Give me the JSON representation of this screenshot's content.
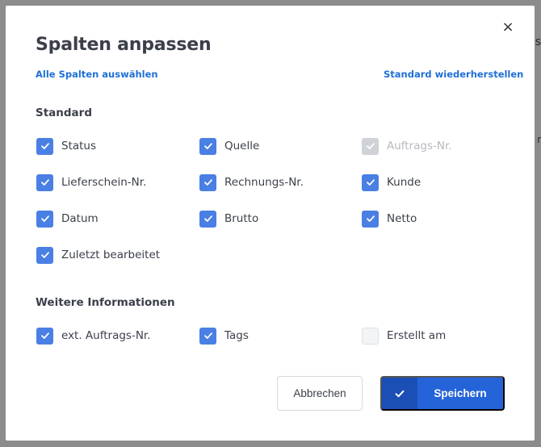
{
  "backdrop": {
    "edge_text_1": "s",
    "edge_text_2": "r"
  },
  "dialog": {
    "title": "Spalten anpassen",
    "close_label": "×",
    "select_all_label": "Alle Spalten auswählen",
    "reset_label": "Standard wiederherstellen"
  },
  "sections": {
    "standard": {
      "title": "Standard",
      "items": [
        {
          "label": "Status",
          "checked": true,
          "disabled": false
        },
        {
          "label": "Quelle",
          "checked": true,
          "disabled": false
        },
        {
          "label": "Auftrags-Nr.",
          "checked": true,
          "disabled": true
        },
        {
          "label": "Lieferschein-Nr.",
          "checked": true,
          "disabled": false
        },
        {
          "label": "Rechnungs-Nr.",
          "checked": true,
          "disabled": false
        },
        {
          "label": "Kunde",
          "checked": true,
          "disabled": false
        },
        {
          "label": "Datum",
          "checked": true,
          "disabled": false
        },
        {
          "label": "Brutto",
          "checked": true,
          "disabled": false
        },
        {
          "label": "Netto",
          "checked": true,
          "disabled": false
        },
        {
          "label": "Zuletzt bearbeitet",
          "checked": true,
          "disabled": false
        }
      ]
    },
    "weitere": {
      "title": "Weitere Informationen",
      "items": [
        {
          "label": "ext. Auftrags-Nr.",
          "checked": true,
          "disabled": false
        },
        {
          "label": "Tags",
          "checked": true,
          "disabled": false
        },
        {
          "label": "Erstellt am",
          "checked": false,
          "disabled": false
        }
      ]
    }
  },
  "footer": {
    "cancel_label": "Abbrechen",
    "save_label": "Speichern"
  },
  "colors": {
    "accent": "#2563d9",
    "checkbox": "#4a7fe3",
    "link": "#1f6fd6"
  }
}
